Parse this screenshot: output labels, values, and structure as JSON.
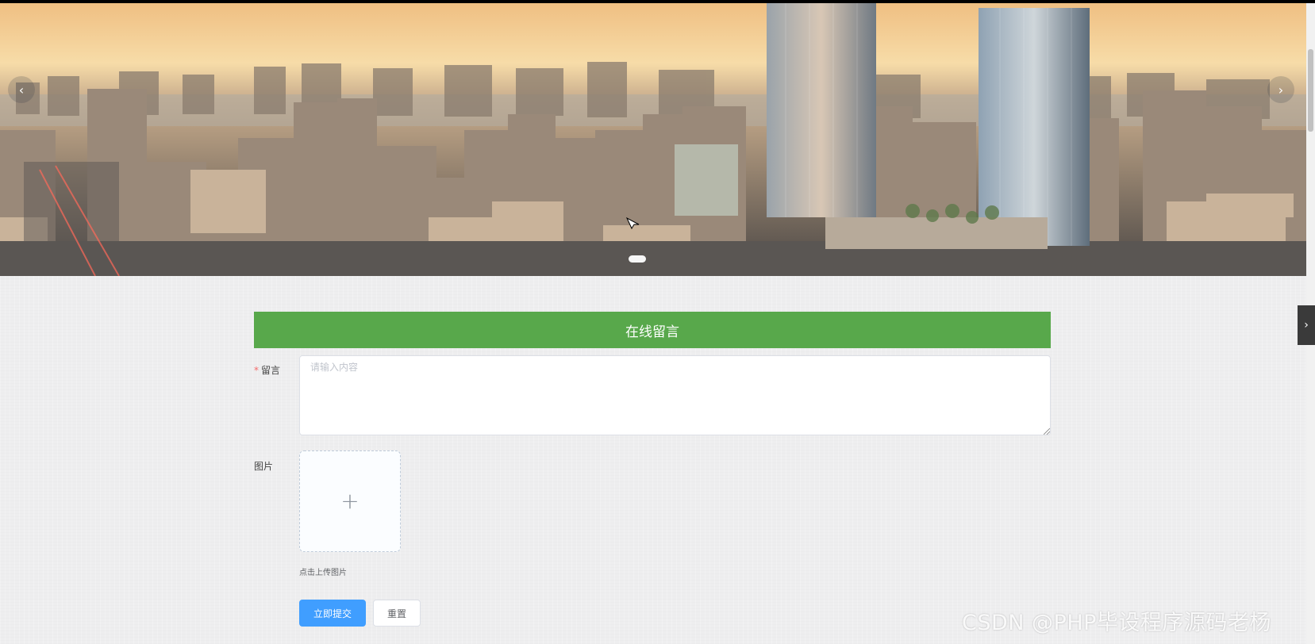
{
  "banner": {
    "prev_icon": "chevron-left-icon",
    "next_icon": "chevron-right-icon",
    "prev_glyph": "‹",
    "next_glyph": "›",
    "slides_visible": 1
  },
  "side_tab": {
    "icon": "chevron-right-icon",
    "glyph": "›"
  },
  "form": {
    "title": "在线留言",
    "message_label": "留言",
    "message_required": "*",
    "message_placeholder": "请输入内容",
    "image_label": "图片",
    "upload_icon": "plus-icon",
    "upload_glyph": "+",
    "upload_hint": "点击上传图片",
    "submit_label": "立即提交",
    "reset_label": "重置"
  },
  "watermark": "CSDN @PHP毕设程序源码老杨",
  "colors": {
    "header_green": "#58a84b",
    "primary_blue": "#409eff",
    "required_red": "#f56c6c"
  }
}
